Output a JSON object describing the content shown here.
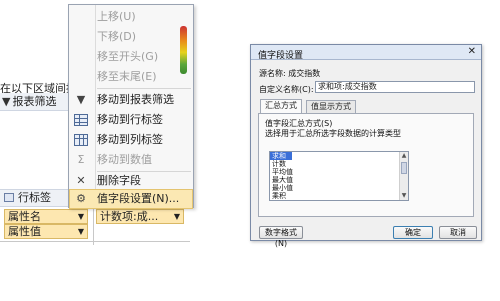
{
  "left_panel": {
    "area_caption": "在以下区域间拖",
    "filter_label": "报表筛选",
    "row_area_header": "行标签",
    "row_fields": [
      {
        "label": "属性名"
      },
      {
        "label": "属性值"
      }
    ],
    "value_field": {
      "label": "计数项:成..."
    }
  },
  "context_menu": {
    "items": [
      {
        "label": "上移(U)",
        "disabled": true,
        "icon": ""
      },
      {
        "label": "下移(D)",
        "disabled": true,
        "icon": ""
      },
      {
        "label": "移至开头(G)",
        "disabled": true,
        "icon": ""
      },
      {
        "label": "移至末尾(E)",
        "disabled": true,
        "icon": ""
      },
      {
        "label": "移动到报表筛选",
        "disabled": false,
        "icon": "filter-icon"
      },
      {
        "label": "移动到行标签",
        "disabled": false,
        "icon": "row-grid-icon"
      },
      {
        "label": "移动到列标签",
        "disabled": false,
        "icon": "column-grid-icon"
      },
      {
        "label": "移动到数值",
        "disabled": true,
        "icon": "sigma-icon"
      },
      {
        "label": "删除字段",
        "disabled": false,
        "icon": "delete-x-icon"
      },
      {
        "label": "值字段设置(N)...",
        "disabled": false,
        "icon": "field-settings-icon",
        "highlighted": true
      }
    ]
  },
  "dialog": {
    "title": "值字段设置",
    "close_glyph": "✕",
    "source_label": "源名称:",
    "source_value": "成交指数",
    "custom_name_label": "自定义名称(C):",
    "custom_name_value": "求和项:成交指数",
    "tabs": [
      {
        "label": "汇总方式",
        "active": true
      },
      {
        "label": "值显示方式",
        "active": false
      }
    ],
    "group_label": "值字段汇总方式(S)",
    "group_description": "选择用于汇总所选字段数据的计算类型",
    "calc_options": [
      {
        "label": "求和",
        "selected": true
      },
      {
        "label": "计数",
        "selected": false
      },
      {
        "label": "平均值",
        "selected": false
      },
      {
        "label": "最大值",
        "selected": false
      },
      {
        "label": "最小值",
        "selected": false
      },
      {
        "label": "乘积",
        "selected": false
      }
    ],
    "buttons": {
      "number_format": "数字格式(N)",
      "ok": "确定",
      "cancel": "取消"
    }
  },
  "colors": {
    "menu_highlight": "#fbe8b3",
    "field_chip": "#fde7b0",
    "list_selection": "#3a6fd8"
  }
}
